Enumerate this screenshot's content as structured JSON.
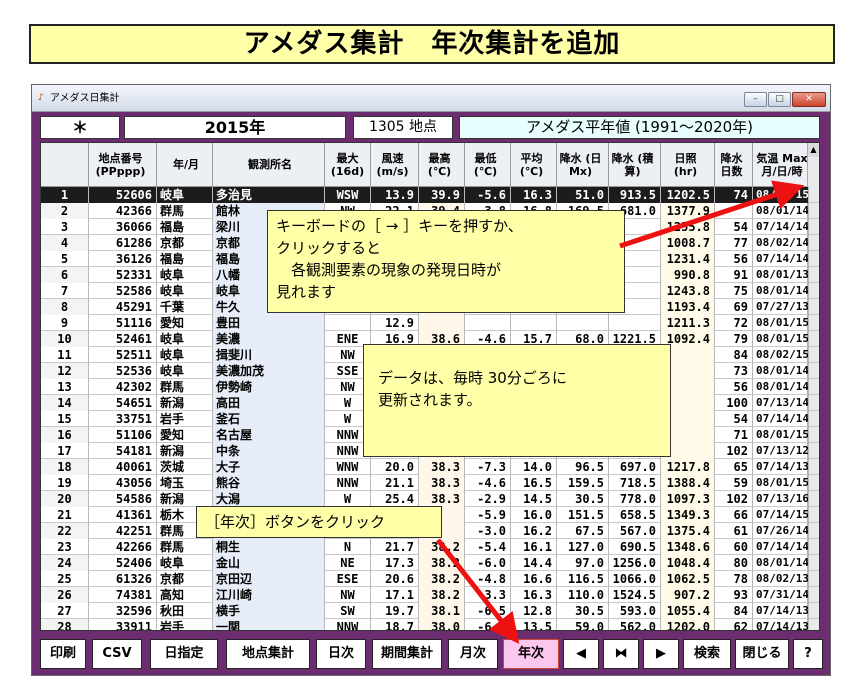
{
  "banner": {
    "title": "アメダス集計　年次集計を追加"
  },
  "window": {
    "title": "アメダス日集計",
    "controls": {
      "minimize": "–",
      "maximize": "□",
      "close": "✕"
    }
  },
  "header": {
    "asterisk": "＊",
    "year": "2015年",
    "count": "1305 地点",
    "normal_period": "アメダス平年値 (1991～2020年)"
  },
  "table": {
    "columns": [
      {
        "key": "idx",
        "label": ""
      },
      {
        "key": "id",
        "label": "地点番号 (PPppp)"
      },
      {
        "key": "pref",
        "label": "年/月"
      },
      {
        "key": "name",
        "label": "観測所名"
      },
      {
        "key": "dir",
        "label": "最大 (16d)"
      },
      {
        "key": "wind",
        "label": "風速 (m/s)"
      },
      {
        "key": "tmax",
        "label": "最高 (℃)"
      },
      {
        "key": "tmin",
        "label": "最低 (℃)"
      },
      {
        "key": "tavg",
        "label": "平均 (℃)"
      },
      {
        "key": "prd",
        "label": "降水 (日Mx)"
      },
      {
        "key": "prs",
        "label": "降水 (積算)"
      },
      {
        "key": "sun",
        "label": "日照 (hr)"
      },
      {
        "key": "days",
        "label": "降水 日数"
      },
      {
        "key": "date",
        "label": "気温 Max 月/日/時"
      }
    ],
    "rows": [
      [
        "1",
        "52606",
        "岐阜",
        "多治見",
        "WSW",
        "13.9",
        "39.9",
        "-5.6",
        "16.3",
        "51.0",
        "913.5",
        "1202.5",
        "74",
        "08/01/15"
      ],
      [
        "2",
        "42366",
        "群馬",
        "館林",
        "NW",
        "22.1",
        "39.4",
        "-3.8",
        "16.8",
        "169.5",
        "681.0",
        "1377.9",
        "",
        "08/01/14"
      ],
      [
        "3",
        "36066",
        "福島",
        "梁川",
        "",
        "",
        "",
        "",
        "",
        "",
        "",
        "1255.8",
        "54",
        "07/14/14"
      ],
      [
        "4",
        "61286",
        "京都",
        "京都",
        "",
        "",
        "",
        "",
        "",
        "",
        "",
        "1008.7",
        "77",
        "08/02/14"
      ],
      [
        "5",
        "36126",
        "福島",
        "福島",
        "",
        "",
        "",
        "",
        "",
        "",
        "",
        "1231.4",
        "56",
        "07/14/14"
      ],
      [
        "6",
        "52331",
        "岐阜",
        "八幡",
        "",
        "",
        "",
        "",
        "",
        "",
        "",
        "990.8",
        "91",
        "08/01/13"
      ],
      [
        "7",
        "52586",
        "岐阜",
        "岐阜",
        "",
        "",
        "",
        "",
        "",
        "",
        "",
        "1243.8",
        "75",
        "08/01/14"
      ],
      [
        "8",
        "45291",
        "千葉",
        "牛久",
        "",
        "",
        "",
        "",
        "",
        "",
        "",
        "1193.4",
        "69",
        "07/27/13"
      ],
      [
        "9",
        "51116",
        "愛知",
        "豊田",
        "",
        "12.9",
        "",
        "",
        "",
        "",
        "",
        "1211.3",
        "72",
        "08/01/15"
      ],
      [
        "10",
        "52461",
        "岐阜",
        "美濃",
        "ENE",
        "16.9",
        "38.6",
        "-4.6",
        "15.7",
        "68.0",
        "1221.5",
        "1092.4",
        "79",
        "08/01/15"
      ],
      [
        "11",
        "52511",
        "岐阜",
        "揖斐川",
        "NW",
        "",
        "",
        "",
        "",
        "",
        "",
        "",
        "84",
        "08/02/15"
      ],
      [
        "12",
        "52536",
        "岐阜",
        "美濃加茂",
        "SSE",
        "",
        "",
        "",
        "",
        "",
        "",
        "",
        "73",
        "08/01/14"
      ],
      [
        "13",
        "42302",
        "群馬",
        "伊勢崎",
        "NW",
        "",
        "",
        "",
        "",
        "",
        "",
        "",
        "56",
        "08/01/14"
      ],
      [
        "14",
        "54651",
        "新潟",
        "高田",
        "W",
        "",
        "",
        "",
        "",
        "",
        "",
        "",
        "100",
        "07/13/14"
      ],
      [
        "15",
        "33751",
        "岩手",
        "釜石",
        "W",
        "",
        "",
        "",
        "",
        "",
        "",
        "",
        "54",
        "07/14/14"
      ],
      [
        "16",
        "51106",
        "愛知",
        "名古屋",
        "NNW",
        "",
        "",
        "",
        "",
        "",
        "",
        "",
        "71",
        "08/01/15"
      ],
      [
        "17",
        "54181",
        "新潟",
        "中条",
        "NNW",
        "",
        "",
        "",
        "",
        "",
        "",
        "",
        "102",
        "07/13/12"
      ],
      [
        "18",
        "40061",
        "茨城",
        "大子",
        "WNW",
        "20.0",
        "38.3",
        "-7.3",
        "14.0",
        "96.5",
        "697.0",
        "1217.8",
        "65",
        "07/14/13"
      ],
      [
        "19",
        "43056",
        "埼玉",
        "熊谷",
        "NNW",
        "21.1",
        "38.3",
        "-4.6",
        "16.5",
        "159.5",
        "718.5",
        "1388.4",
        "59",
        "08/01/15"
      ],
      [
        "20",
        "54586",
        "新潟",
        "大潟",
        "W",
        "25.4",
        "38.3",
        "-2.9",
        "14.5",
        "30.5",
        "778.0",
        "1097.3",
        "102",
        "07/13/16"
      ],
      [
        "21",
        "41361",
        "栃木",
        "",
        "",
        "",
        "",
        "-5.9",
        "16.0",
        "151.5",
        "658.5",
        "1349.3",
        "66",
        "07/14/15"
      ],
      [
        "22",
        "42251",
        "群馬",
        "",
        "",
        "",
        "",
        "-3.0",
        "16.2",
        "67.5",
        "567.0",
        "1375.4",
        "61",
        "07/26/14"
      ],
      [
        "23",
        "42266",
        "群馬",
        "桐生",
        "N",
        "21.7",
        "38.2",
        "-5.4",
        "16.1",
        "127.0",
        "690.5",
        "1348.6",
        "60",
        "07/14/14"
      ],
      [
        "24",
        "52406",
        "岐阜",
        "金山",
        "NE",
        "17.3",
        "38.2",
        "-6.0",
        "14.4",
        "97.0",
        "1256.0",
        "1048.4",
        "80",
        "08/01/14"
      ],
      [
        "25",
        "61326",
        "京都",
        "京田辺",
        "ESE",
        "20.6",
        "38.2",
        "-4.8",
        "16.6",
        "116.5",
        "1066.0",
        "1062.5",
        "78",
        "08/02/13"
      ],
      [
        "26",
        "74381",
        "高知",
        "江川崎",
        "NW",
        "17.1",
        "38.2",
        "-3.3",
        "16.3",
        "110.0",
        "1524.5",
        "907.2",
        "93",
        "07/31/14"
      ],
      [
        "27",
        "32596",
        "秋田",
        "横手",
        "SW",
        "19.7",
        "38.1",
        "-6.5",
        "12.8",
        "30.5",
        "593.0",
        "1055.4",
        "84",
        "07/14/13"
      ],
      [
        "28",
        "33911",
        "岩手",
        "一関",
        "NNW",
        "18.7",
        "38.0",
        "-6.4",
        "13.5",
        "59.0",
        "562.0",
        "1202.0",
        "62",
        "07/14/13"
      ]
    ]
  },
  "buttons": {
    "print": "印刷",
    "csv": "CSV",
    "date_select": "日指定",
    "station": "地点集計",
    "daily": "日次",
    "period": "期間集計",
    "monthly": "月次",
    "yearly": "年次",
    "prev": "◀",
    "center": "⧓",
    "next": "▶",
    "search": "検索",
    "close": "閉じる",
    "help": "?"
  },
  "callouts": {
    "keyboard": [
      "キーボードの［ → ］キーを押すか、",
      "クリックすると",
      "　各観測要素の現象の発現日時が",
      "見れます"
    ],
    "update": [
      "データは、毎時 30分ごろに",
      "更新されます。"
    ],
    "yearly": "［年次］ボタンをクリック"
  },
  "colors": {
    "accent": "#6b2c70",
    "callout": "#ffffa8",
    "arrow": "#ee1111",
    "active_button": "#fcc7ef"
  }
}
